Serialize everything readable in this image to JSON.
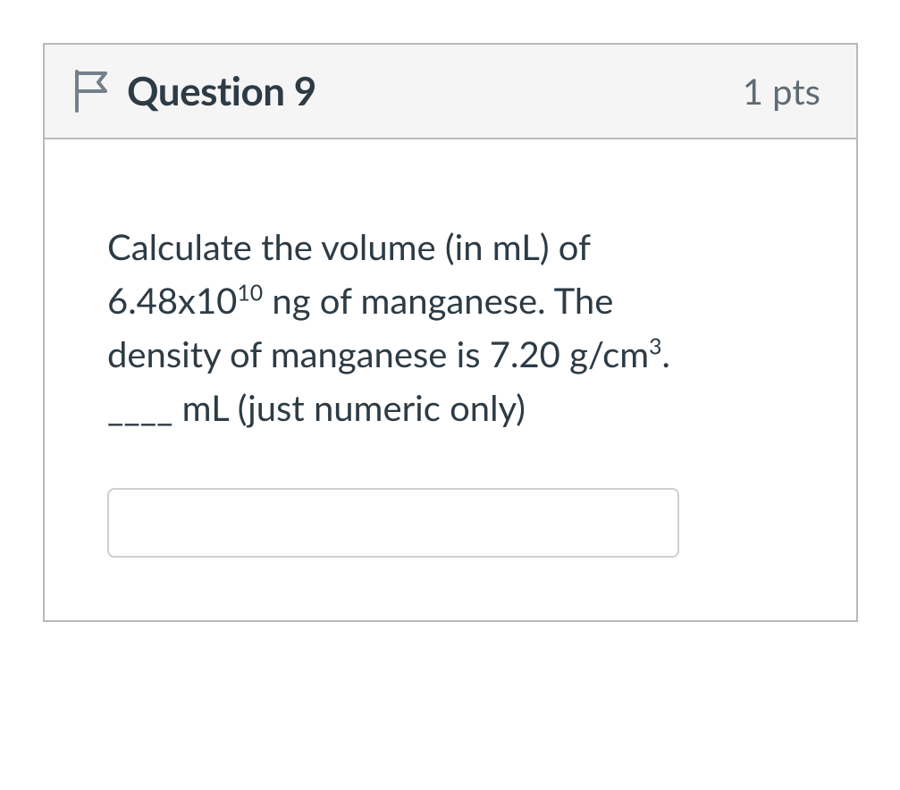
{
  "header": {
    "title": "Question 9",
    "points": "1 pts"
  },
  "body": {
    "line1": "Calculate the volume (in mL) of",
    "line2a": "6.48x10",
    "line2sup": "10",
    "line2b": " ng of manganese.  The",
    "line3a": "density of manganese is 7.20 g/cm",
    "line3sup": "3",
    "line3b": ".",
    "line4": "____ mL (just numeric only)"
  },
  "input": {
    "value": ""
  }
}
